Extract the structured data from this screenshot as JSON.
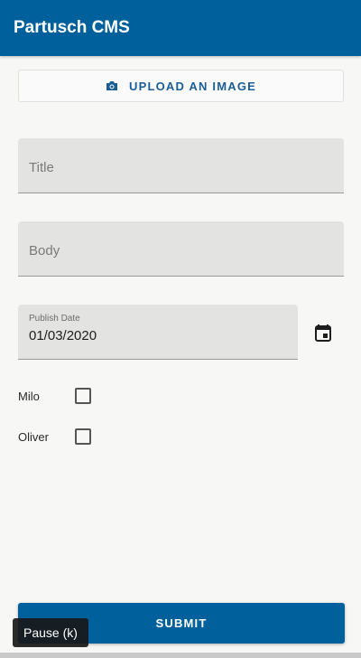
{
  "app": {
    "title": "Partusch CMS"
  },
  "upload": {
    "label": "UPLOAD AN IMAGE",
    "icon": "camera-icon"
  },
  "form": {
    "title_placeholder": "Title",
    "body_placeholder": "Body",
    "publish_date": {
      "label": "Publish Date",
      "value": "01/03/2020",
      "icon": "calendar-icon"
    },
    "checkboxes": [
      {
        "label": "Milo",
        "checked": false
      },
      {
        "label": "Oliver",
        "checked": false
      }
    ],
    "submit_label": "SUBMIT"
  },
  "video_overlay": {
    "tooltip": "Pause (k)"
  },
  "colors": {
    "primary": "#00609c",
    "field_bg": "#e3e3e1",
    "page_bg": "#f7f7f5"
  }
}
